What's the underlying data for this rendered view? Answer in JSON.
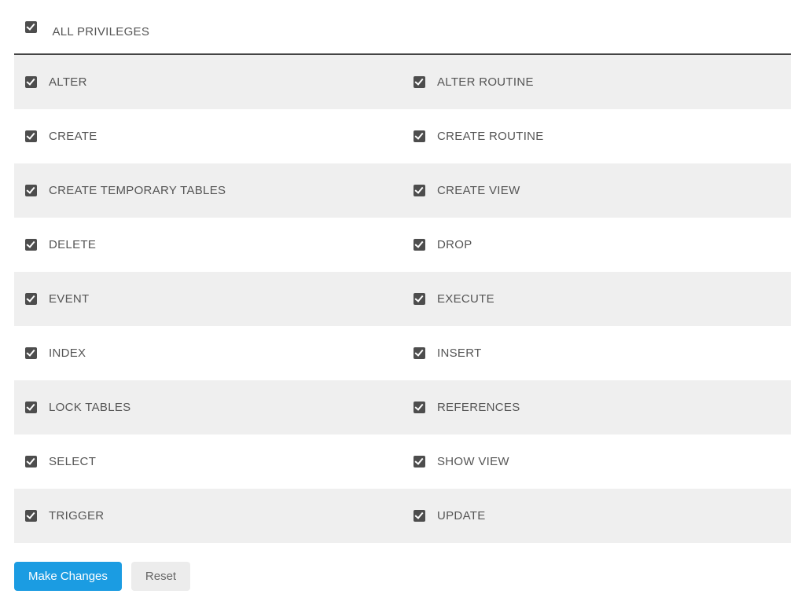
{
  "allPrivileges": {
    "label": "ALL PRIVILEGES",
    "checked": true
  },
  "rows": [
    {
      "left": {
        "label": "ALTER",
        "checked": true
      },
      "right": {
        "label": "ALTER ROUTINE",
        "checked": true
      }
    },
    {
      "left": {
        "label": "CREATE",
        "checked": true
      },
      "right": {
        "label": "CREATE ROUTINE",
        "checked": true
      }
    },
    {
      "left": {
        "label": "CREATE TEMPORARY TABLES",
        "checked": true
      },
      "right": {
        "label": "CREATE VIEW",
        "checked": true
      }
    },
    {
      "left": {
        "label": "DELETE",
        "checked": true
      },
      "right": {
        "label": "DROP",
        "checked": true
      }
    },
    {
      "left": {
        "label": "EVENT",
        "checked": true
      },
      "right": {
        "label": "EXECUTE",
        "checked": true
      }
    },
    {
      "left": {
        "label": "INDEX",
        "checked": true
      },
      "right": {
        "label": "INSERT",
        "checked": true
      }
    },
    {
      "left": {
        "label": "LOCK TABLES",
        "checked": true
      },
      "right": {
        "label": "REFERENCES",
        "checked": true
      }
    },
    {
      "left": {
        "label": "SELECT",
        "checked": true
      },
      "right": {
        "label": "SHOW VIEW",
        "checked": true
      }
    },
    {
      "left": {
        "label": "TRIGGER",
        "checked": true
      },
      "right": {
        "label": "UPDATE",
        "checked": true
      }
    }
  ],
  "buttons": {
    "primary": "Make Changes",
    "secondary": "Reset"
  }
}
